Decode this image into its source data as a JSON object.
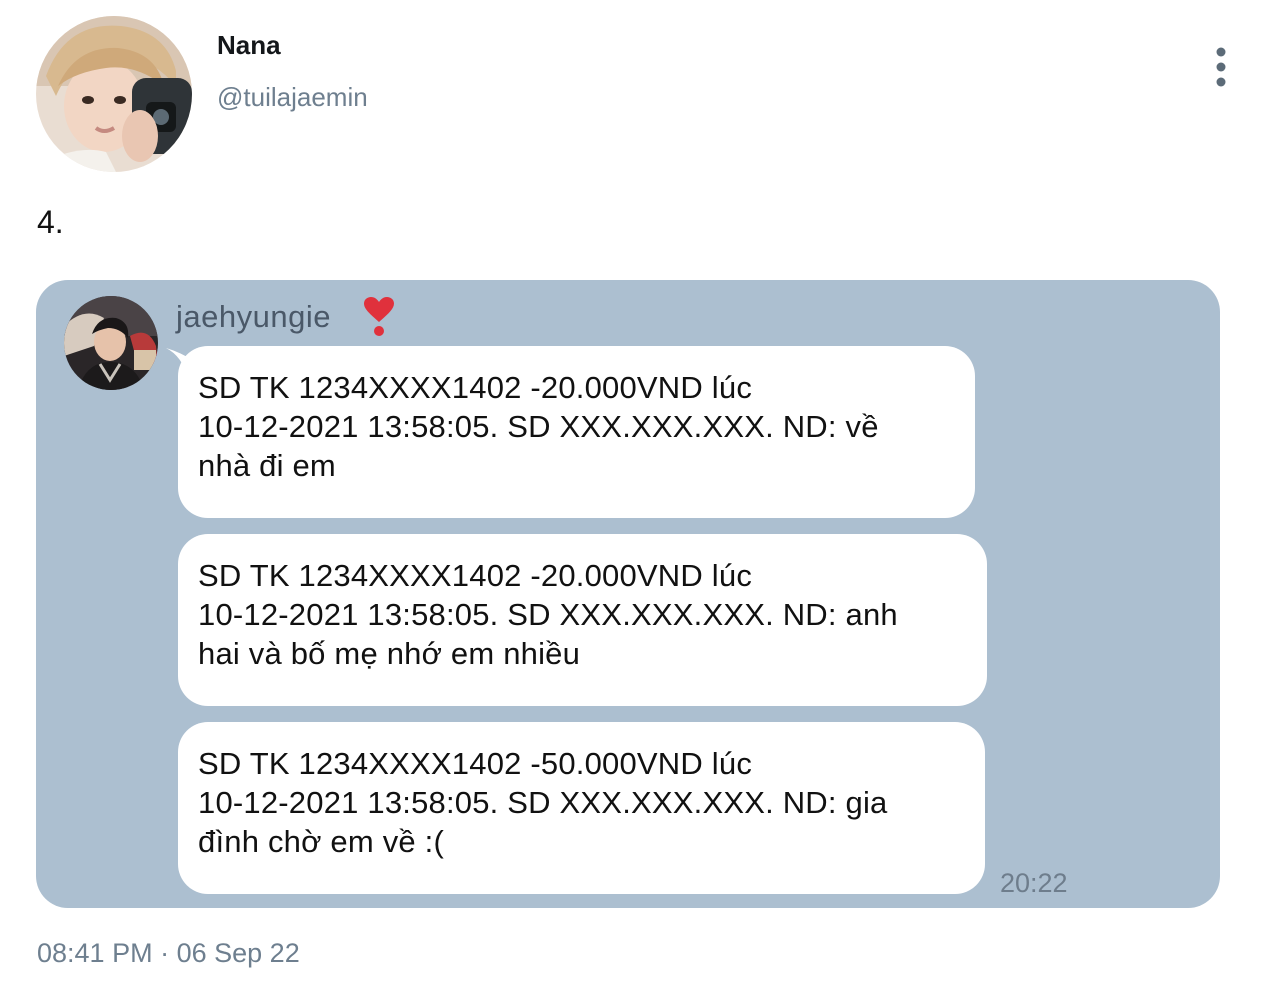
{
  "author": {
    "display_name": "Nana",
    "handle": "@tuilajaemin",
    "avatar_icon": "profile-photo"
  },
  "more_options_icon": "vertical-ellipsis-icon",
  "tweet": {
    "text": "4.",
    "timestamp": "08:41 PM",
    "separator": "·",
    "date": "06 Sep 22"
  },
  "chat_screenshot": {
    "background_color": "#acbfd0",
    "sender": {
      "name": "jaehyungie",
      "emoji_icon": "red-heart-exclamation-icon"
    },
    "messages": [
      {
        "line1": "SD TK 1234XXXX1402 -20.000VND lúc",
        "line2": "10-12-2021 13:58:05. SD XXX.XXX.XXX. ND: về",
        "line3": "nhà đi em"
      },
      {
        "line1": "SD TK 1234XXXX1402 -20.000VND lúc",
        "line2": "10-12-2021 13:58:05. SD XXX.XXX.XXX. ND: anh",
        "line3": "hai và bố mẹ nhớ em nhiều"
      },
      {
        "line1": "SD TK 1234XXXX1402 -50.000VND lúc",
        "line2": "10-12-2021 13:58:05. SD XXX.XXX.XXX. ND: gia",
        "line3": "đình chờ em về :("
      }
    ],
    "time": "20:22"
  }
}
